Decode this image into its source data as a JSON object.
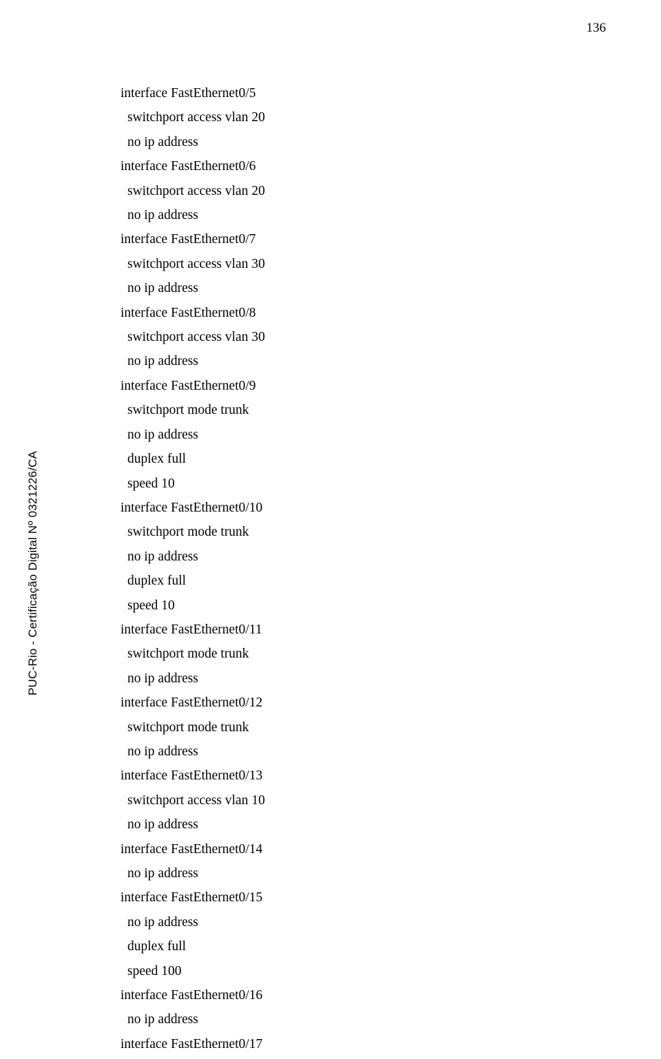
{
  "pageNumber": "136",
  "watermark": "PUC-Rio - Certificação Digital Nº 0321226/CA",
  "lines": [
    {
      "indent": false,
      "text": "interface FastEthernet0/5"
    },
    {
      "indent": true,
      "text": "switchport access vlan 20"
    },
    {
      "indent": true,
      "text": "no ip address"
    },
    {
      "indent": false,
      "text": "interface FastEthernet0/6"
    },
    {
      "indent": true,
      "text": "switchport access vlan 20"
    },
    {
      "indent": true,
      "text": "no ip address"
    },
    {
      "indent": false,
      "text": "interface FastEthernet0/7"
    },
    {
      "indent": true,
      "text": "switchport access vlan 30"
    },
    {
      "indent": true,
      "text": "no ip address"
    },
    {
      "indent": false,
      "text": "interface FastEthernet0/8"
    },
    {
      "indent": true,
      "text": "switchport access vlan 30"
    },
    {
      "indent": true,
      "text": "no ip address"
    },
    {
      "indent": false,
      "text": "interface FastEthernet0/9"
    },
    {
      "indent": true,
      "text": "switchport mode trunk"
    },
    {
      "indent": true,
      "text": "no ip address"
    },
    {
      "indent": true,
      "text": "duplex full"
    },
    {
      "indent": true,
      "text": "speed 10"
    },
    {
      "indent": false,
      "text": "interface FastEthernet0/10"
    },
    {
      "indent": true,
      "text": "switchport mode trunk"
    },
    {
      "indent": true,
      "text": "no ip address"
    },
    {
      "indent": true,
      "text": "duplex full"
    },
    {
      "indent": true,
      "text": "speed 10"
    },
    {
      "indent": false,
      "text": "interface FastEthernet0/11"
    },
    {
      "indent": true,
      "text": "switchport mode trunk"
    },
    {
      "indent": true,
      "text": "no ip address"
    },
    {
      "indent": false,
      "text": "interface FastEthernet0/12"
    },
    {
      "indent": true,
      "text": "switchport mode trunk"
    },
    {
      "indent": true,
      "text": "no ip address"
    },
    {
      "indent": false,
      "text": "interface FastEthernet0/13"
    },
    {
      "indent": true,
      "text": "switchport access vlan 10"
    },
    {
      "indent": true,
      "text": "no ip address"
    },
    {
      "indent": false,
      "text": "interface FastEthernet0/14"
    },
    {
      "indent": true,
      "text": "no ip address"
    },
    {
      "indent": false,
      "text": "interface FastEthernet0/15"
    },
    {
      "indent": true,
      "text": "no ip address"
    },
    {
      "indent": true,
      "text": "duplex full"
    },
    {
      "indent": true,
      "text": "speed 100"
    },
    {
      "indent": false,
      "text": "interface FastEthernet0/16"
    },
    {
      "indent": true,
      "text": "no ip address"
    },
    {
      "indent": false,
      "text": "interface FastEthernet0/17"
    }
  ]
}
